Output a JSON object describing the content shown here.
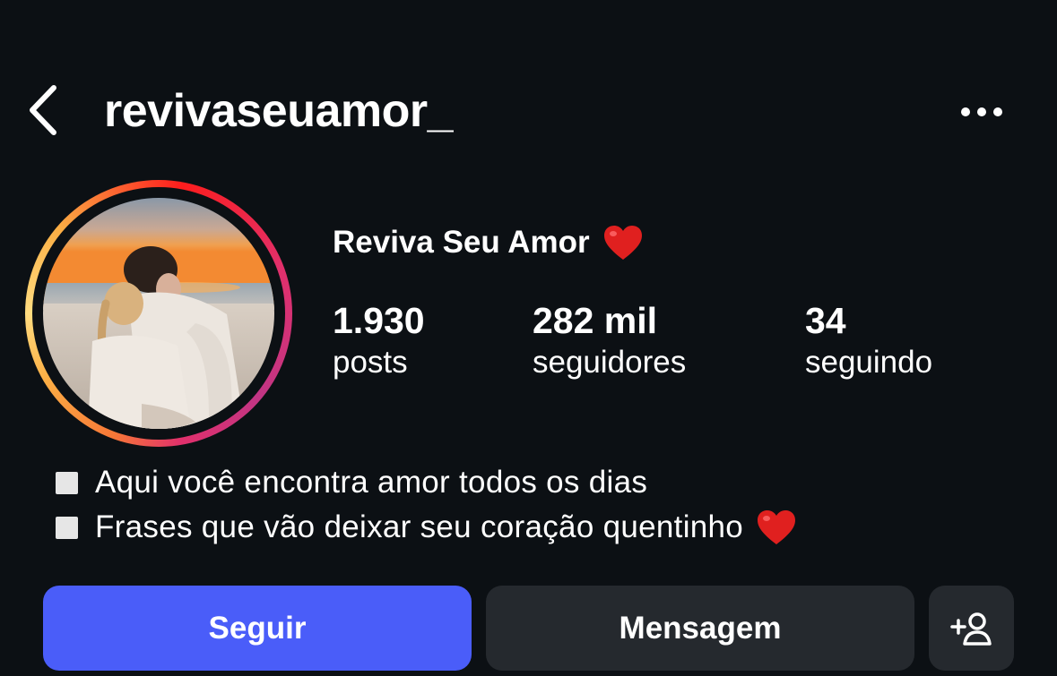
{
  "header": {
    "username": "revivaseuamor_",
    "back_icon": "chevron-left-icon",
    "more_icon": "ellipsis-icon"
  },
  "profile": {
    "display_name": "Reviva Seu Amor",
    "display_name_emoji": "heart-icon",
    "avatar_description_icon": "avatar",
    "stats": {
      "posts": {
        "value": "1.930",
        "label": "posts"
      },
      "followers": {
        "value": "282 mil",
        "label": "seguidores"
      },
      "following": {
        "value": "34",
        "label": "seguindo"
      }
    }
  },
  "bio": {
    "lines": [
      {
        "text": "Aqui você encontra amor todos os dias",
        "emoji": ""
      },
      {
        "text": "Frases que vão deixar seu coração quentinho",
        "emoji": "heart-icon"
      }
    ]
  },
  "actions": {
    "follow_label": "Seguir",
    "message_label": "Mensagem",
    "suggest_icon": "add-person-icon"
  },
  "colors": {
    "background": "#0c1014",
    "follow_button": "#4a5df9",
    "secondary_button": "#25292e",
    "heart": "#e0201f",
    "ring_gradient": [
      "#fcaf45",
      "#fd1d1d",
      "#e1306c",
      "#c13584"
    ]
  }
}
